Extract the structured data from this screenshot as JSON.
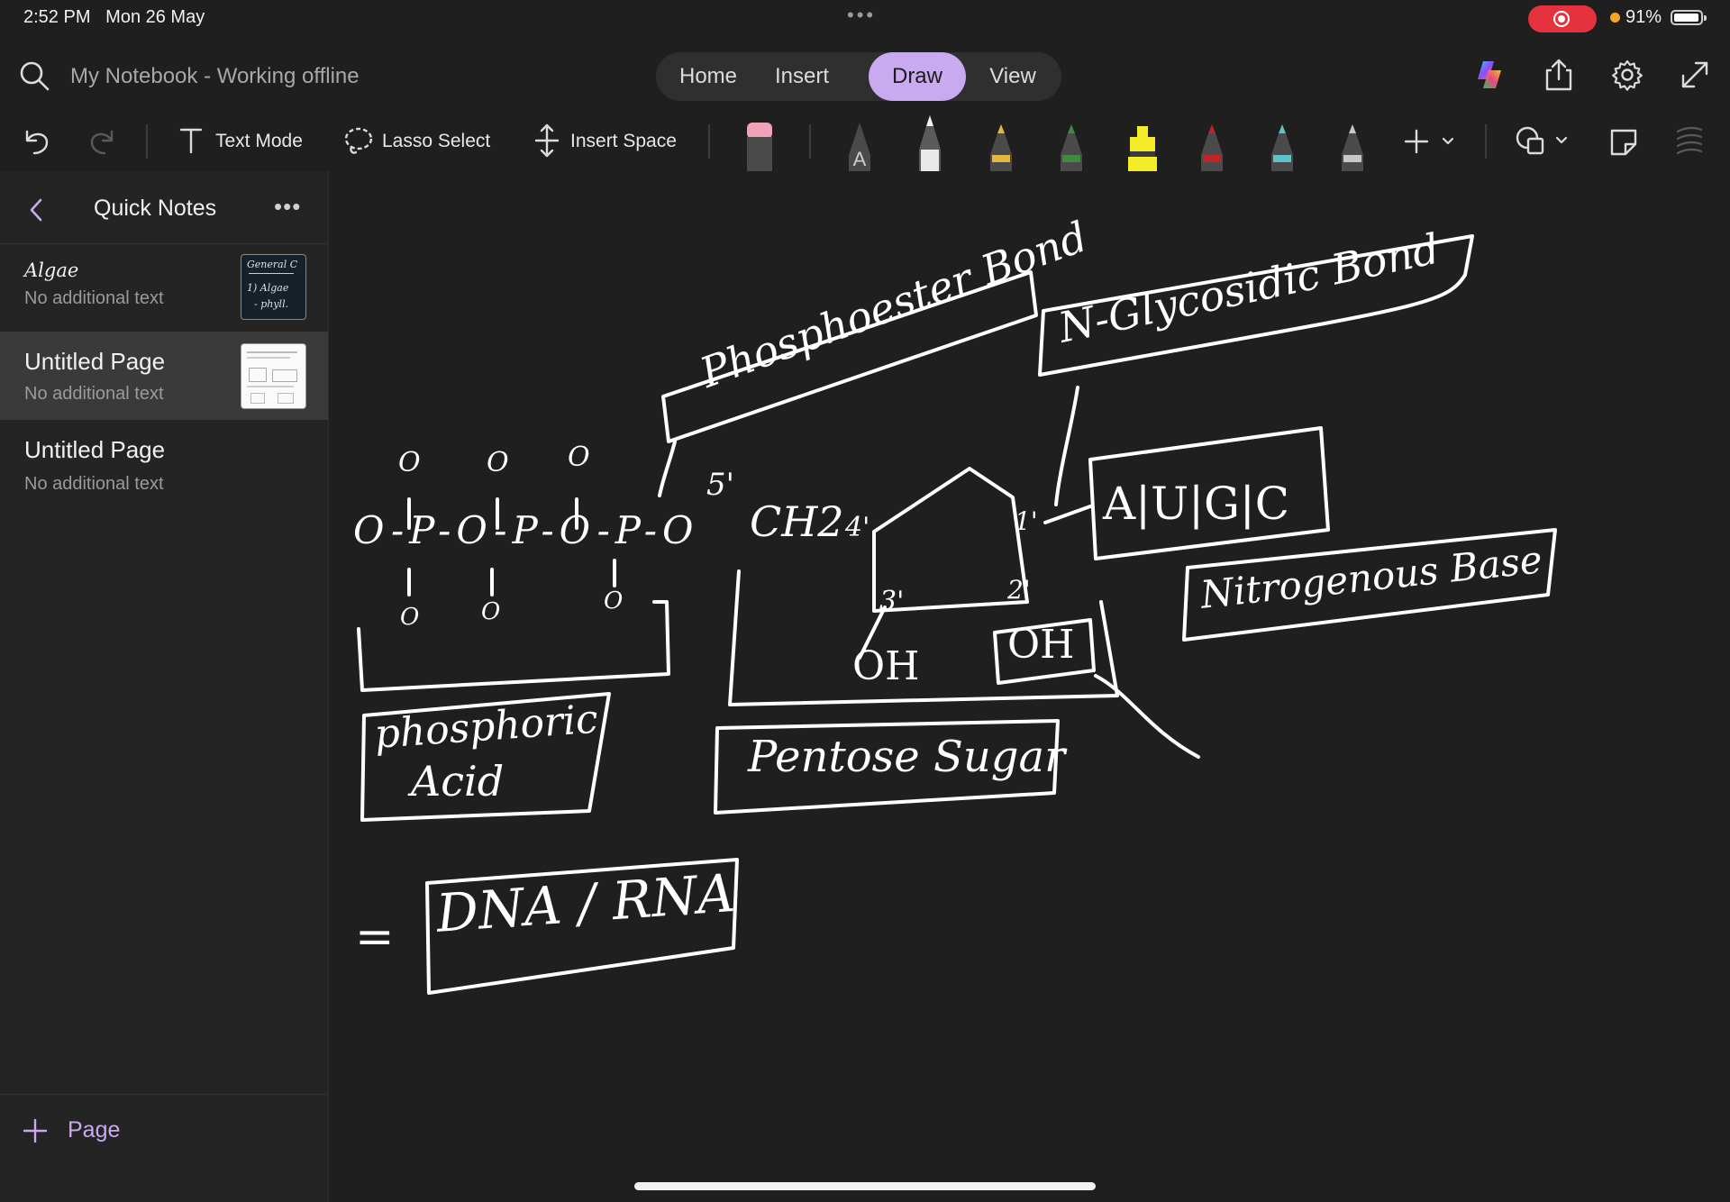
{
  "status": {
    "time": "2:52 PM",
    "date": "Mon 26 May",
    "battery": "91%"
  },
  "header": {
    "notebook_title": "My Notebook - Working offline",
    "tabs": [
      {
        "label": "Home"
      },
      {
        "label": "Insert"
      },
      {
        "label": "Draw",
        "active": true
      },
      {
        "label": "View"
      }
    ]
  },
  "toolbar": {
    "text_mode": "Text Mode",
    "lasso_select": "Lasso Select",
    "insert_space": "Insert Space",
    "pen_colors": [
      "#d8d8d8",
      "#f2f2f2",
      "#e3b93a",
      "#3f8a3f",
      "#f4ec28",
      "#c0232a",
      "#5bc4c8",
      "#c8c8c8"
    ]
  },
  "sidebar": {
    "title": "Quick Notes",
    "pages": [
      {
        "title": "Algae",
        "subtitle": "No additional text",
        "thumb": {
          "line1": "General C",
          "line2": "1) Algae",
          "line3": "- phyll."
        }
      },
      {
        "title": "Untitled Page",
        "subtitle": "No additional text",
        "selected": true
      },
      {
        "title": "Untitled Page",
        "subtitle": "No additional text"
      }
    ],
    "add_page": "Page"
  },
  "ink": {
    "phosphoester": "Phosphoester Bond",
    "glycosidic": "N-Glycosidic Bond",
    "bases": "A|U|G|C",
    "nitrogenous": "Nitrogenous Base",
    "phosphoric_1": "phosphoric",
    "phosphoric_2": "Acid",
    "pentose": "Pentose Sugar",
    "dna_rna": "DNA / RNA",
    "equals": "=",
    "chain": "O-P-O-P-O-P-O",
    "top_o": "O",
    "bottom_o": "O",
    "five_prime": "5'",
    "ch2": "CH2",
    "four_prime": "4'",
    "one_prime": "1'",
    "three_prime": "3'",
    "two_prime": "2'",
    "oh_left": "OH",
    "oh_right": "OH"
  }
}
